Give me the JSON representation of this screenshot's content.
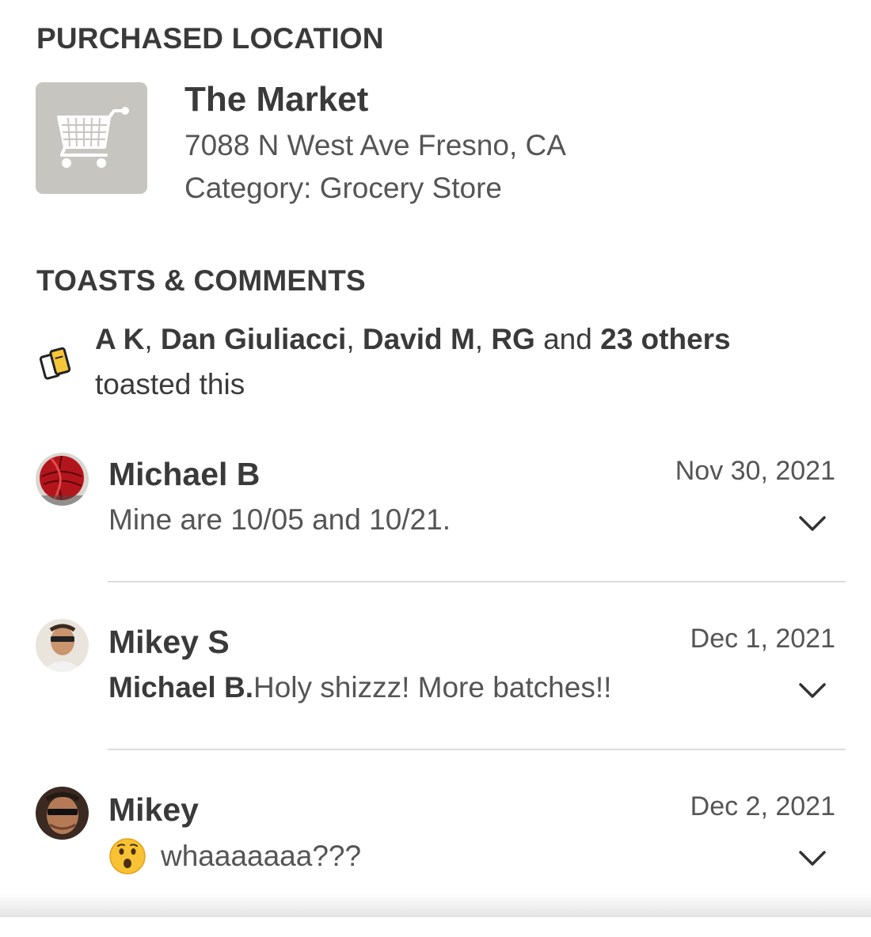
{
  "purchased_location": {
    "header": "PURCHASED LOCATION",
    "thumbnail_icon": "shopping-cart-icon",
    "name": "The Market",
    "address": "7088 N West Ave Fresno, CA",
    "category": "Category: Grocery Store"
  },
  "toasts": {
    "header": "TOASTS & COMMENTS",
    "icon": "toast-icon",
    "names": [
      "A K",
      "Dan Giuliacci",
      "David M",
      "RG"
    ],
    "separator": ", ",
    "and_word": " and ",
    "others": "23 others",
    "suffix": "toasted this"
  },
  "comments": [
    {
      "author": "Michael B",
      "date": "Nov 30, 2021",
      "mention": "",
      "text": "Mine are 10/05 and 10/21.",
      "emoji": ""
    },
    {
      "author": "Mikey S",
      "date": "Dec 1, 2021",
      "mention": "Michael B.",
      "text": "Holy shizzz! More batches!!",
      "emoji": ""
    },
    {
      "author": "Mikey",
      "date": "Dec 2, 2021",
      "mention": "",
      "text": "whaaaaaaa???",
      "emoji": "surprised-face-emoji"
    }
  ],
  "colors": {
    "text_primary": "#3a3a3a",
    "text_secondary": "#555555",
    "thumbnail_bg": "#c7c5c0",
    "divider": "#dcdcdc",
    "toast_icon_fill": "#f6c63a"
  }
}
